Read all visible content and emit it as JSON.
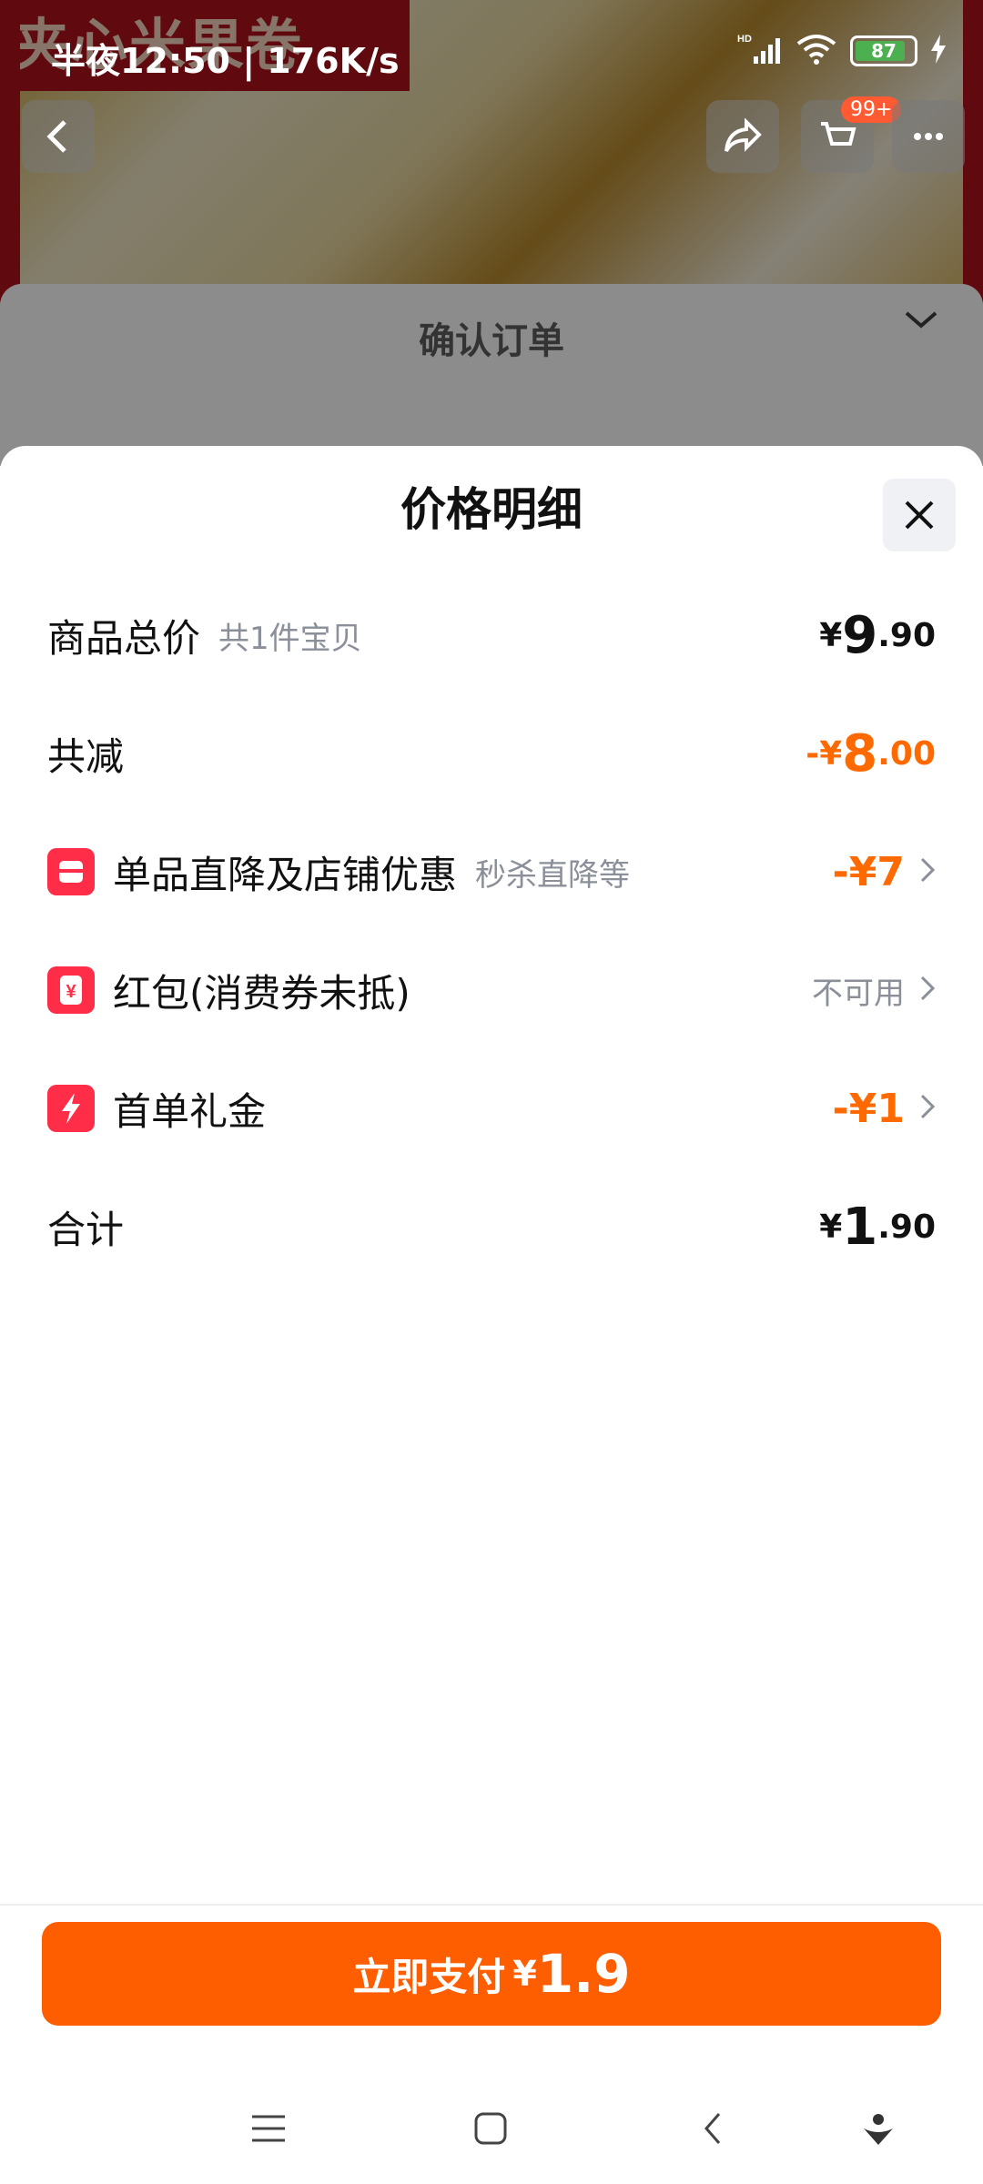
{
  "status_bar": {
    "time": "半夜12:50 | 176K/s",
    "battery": "87"
  },
  "background": {
    "banner_text": "夹心米果卷",
    "cart_badge": "99+",
    "order_title": "确认订单"
  },
  "modal": {
    "title": "价格明细",
    "rows": [
      {
        "label": "商品总价",
        "sub": "共1件宝贝",
        "price_yen": "¥",
        "price_int": "9",
        "price_dec": ".90"
      },
      {
        "label": "共减",
        "price_yen": "-¥",
        "price_int": "8",
        "price_dec": ".00"
      },
      {
        "label": "单品直降及店铺优惠",
        "sub": "秒杀直降等",
        "value": "-¥7",
        "icon": "store-icon"
      },
      {
        "label": "红包(消费券未抵)",
        "value": "不可用",
        "icon": "red-packet-icon"
      },
      {
        "label": "首单礼金",
        "value": "-¥1",
        "icon": "lightning-icon"
      },
      {
        "label": "合计",
        "price_yen": "¥",
        "price_int": "1",
        "price_dec": ".90"
      }
    ]
  },
  "pay_button": {
    "label": "立即支付",
    "yen": "¥",
    "amount": "1.9"
  },
  "colors": {
    "accent": "#ff5e00",
    "discount": "#ff6a00",
    "icon_red": "#ff2d47"
  }
}
